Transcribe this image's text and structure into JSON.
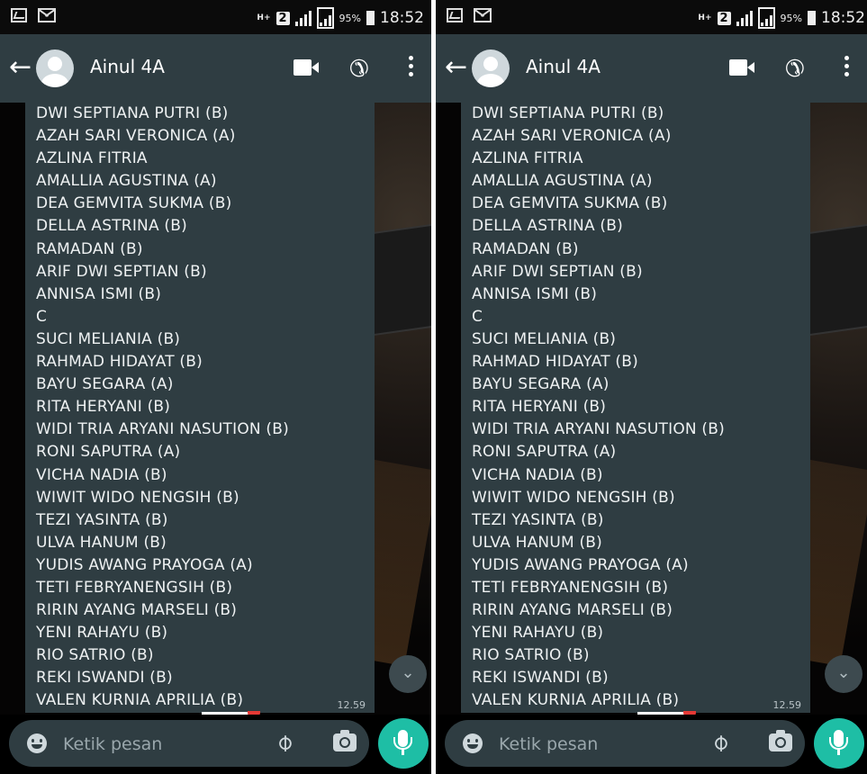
{
  "status_bar": {
    "network_type": "H+",
    "sim_slot": "2",
    "battery_percent": "95%",
    "time": "18:52"
  },
  "chat": {
    "contact_name": "Ainul 4A",
    "message_time": "12.59",
    "lines": [
      "DWI SEPTIANA PUTRI (B)",
      "AZAH SARI VERONICA (A)",
      "AZLINA FITRIA",
      "AMALLIA AGUSTINA (A)",
      "DEA GEMVITA SUKMA (B)",
      "DELLA ASTRINA (B)",
      "RAMADAN (B)",
      "ARIF DWI SEPTIAN (B)",
      "ANNISA ISMI (B)",
      "C",
      "SUCI MELIANIA (B)",
      "RAHMAD HIDAYAT (B)",
      "BAYU SEGARA (A)",
      "RITA HERYANI (B)",
      "WIDI TRIA ARYANI NASUTION (B)",
      "RONI SAPUTRA (A)",
      "VICHA NADIA (B)",
      "WIWIT WIDO NENGSIH (B)",
      "TEZI YASINTA (B)",
      "ULVA HANUM (B)",
      "YUDIS AWANG PRAYOGA (A)",
      "TETI FEBRYANENGSIH (B)",
      "RIRIN AYANG MARSELI (B)",
      "YENI RAHAYU (B)",
      "RIO SATRIO (B)",
      "REKI ISWANDI (B)",
      "VALEN KURNIA APRILIA (B)"
    ]
  },
  "input": {
    "placeholder": "Ketik pesan"
  },
  "icons": {
    "back": "arrow-left-icon",
    "video": "video-call-icon",
    "phone": "phone-icon",
    "menu": "more-vert-icon",
    "emoji": "emoji-icon",
    "attach": "paperclip-icon",
    "camera": "camera-icon",
    "mic": "mic-icon",
    "scroll": "double-chevron-down-icon"
  },
  "colors": {
    "app_bar": "#2f3d42",
    "bubble": "#2f3d42",
    "mic_button": "#1ebea5"
  }
}
